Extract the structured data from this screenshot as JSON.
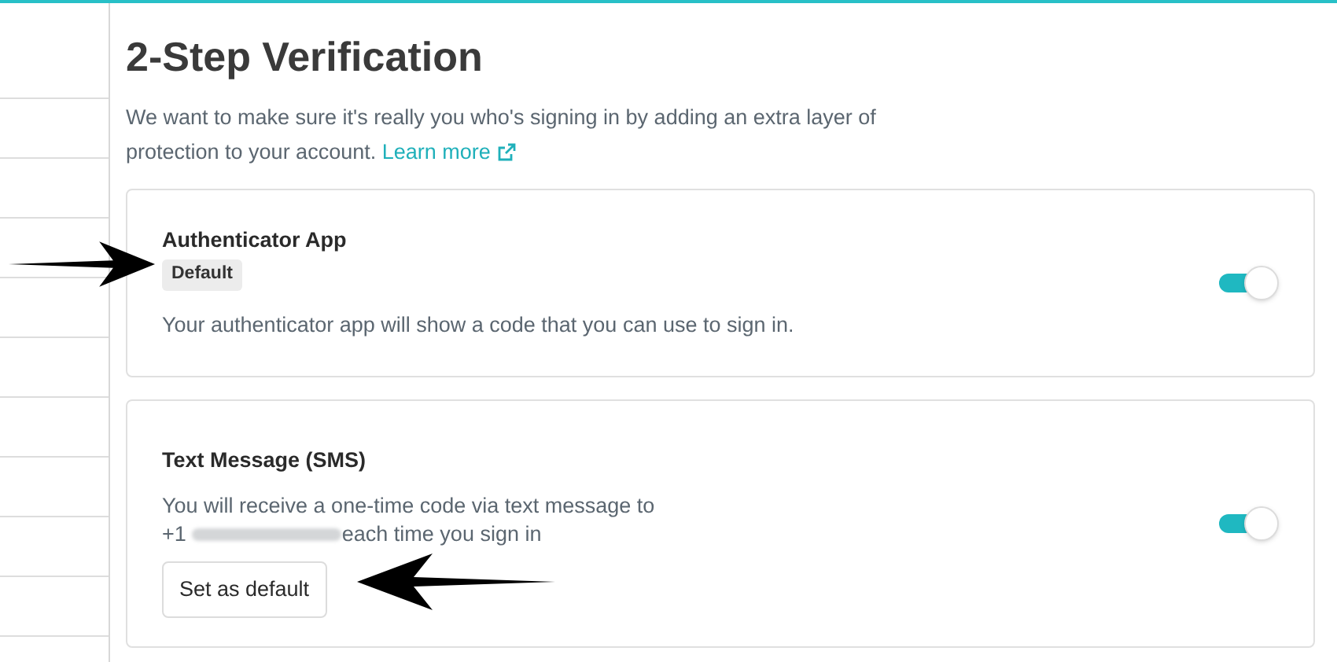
{
  "title": "2-Step Verification",
  "intro": "We want to make sure it's really you who's signing in by adding an extra layer of protection to your account.",
  "learn_more": "Learn more",
  "methods": [
    {
      "name": "Authenticator App",
      "badge": "Default",
      "description": "Your authenticator app will show a code that you can use to sign in.",
      "on": true
    },
    {
      "name": "Text Message (SMS)",
      "description": "You will receive a one-time code via text message to",
      "phone_prefix": "+1",
      "description_end": "each time you sign in",
      "button": "Set as default",
      "on": true
    }
  ]
}
